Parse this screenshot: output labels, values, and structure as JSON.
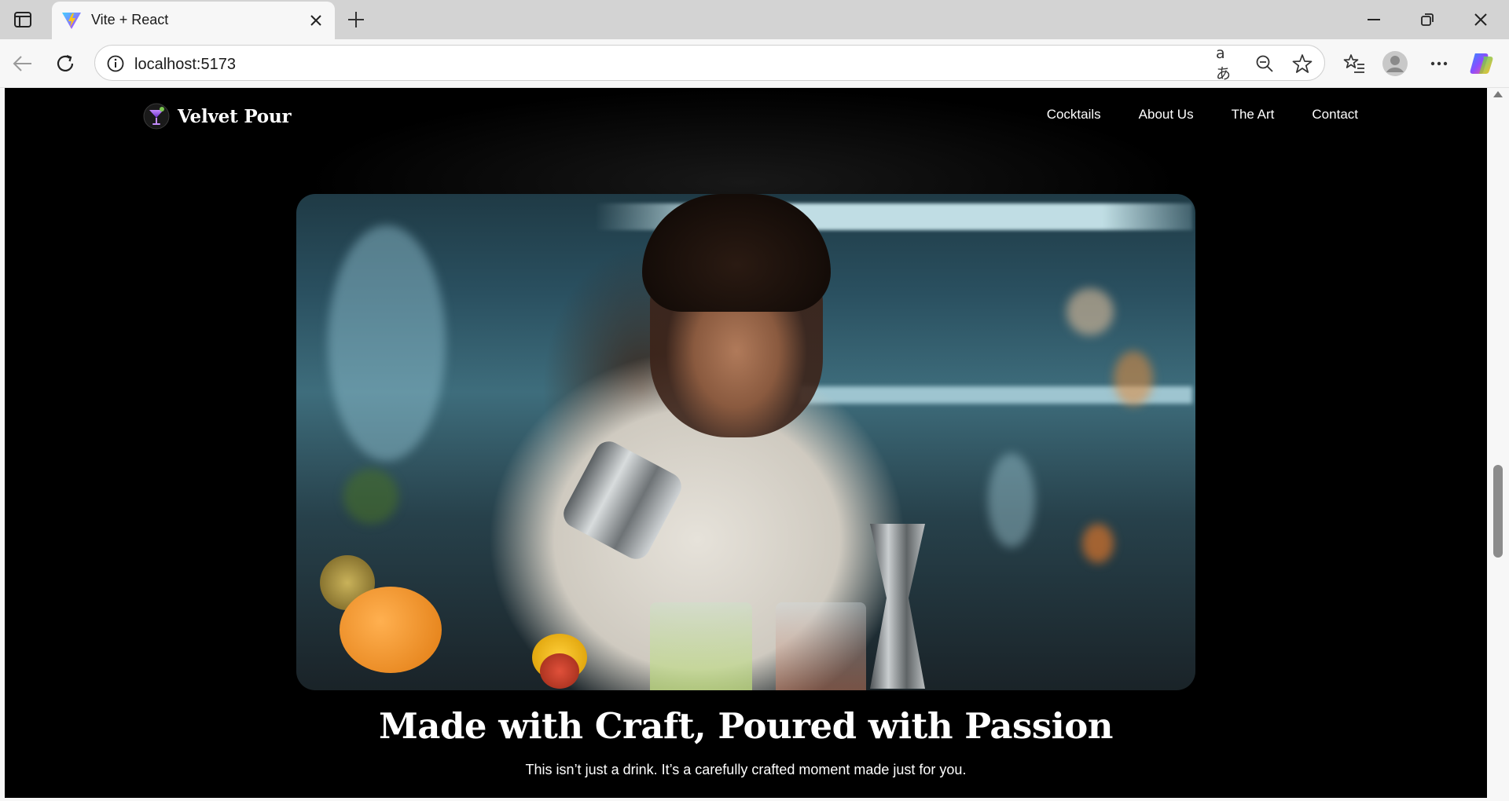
{
  "browser": {
    "tab_title": "Vite + React",
    "url": "localhost:5173"
  },
  "site": {
    "brand": "Velvet Pour",
    "nav": [
      {
        "label": "Cocktails"
      },
      {
        "label": "About Us"
      },
      {
        "label": "The Art"
      },
      {
        "label": "Contact"
      }
    ],
    "hero": {
      "headline": "Made with Craft, Poured with Passion",
      "subline": "This isn’t just a drink. It’s a carefully crafted moment made just for you."
    }
  },
  "colors": {
    "page_bg": "#000000",
    "text": "#ffffff",
    "browser_chrome": "#d3d3d3"
  }
}
